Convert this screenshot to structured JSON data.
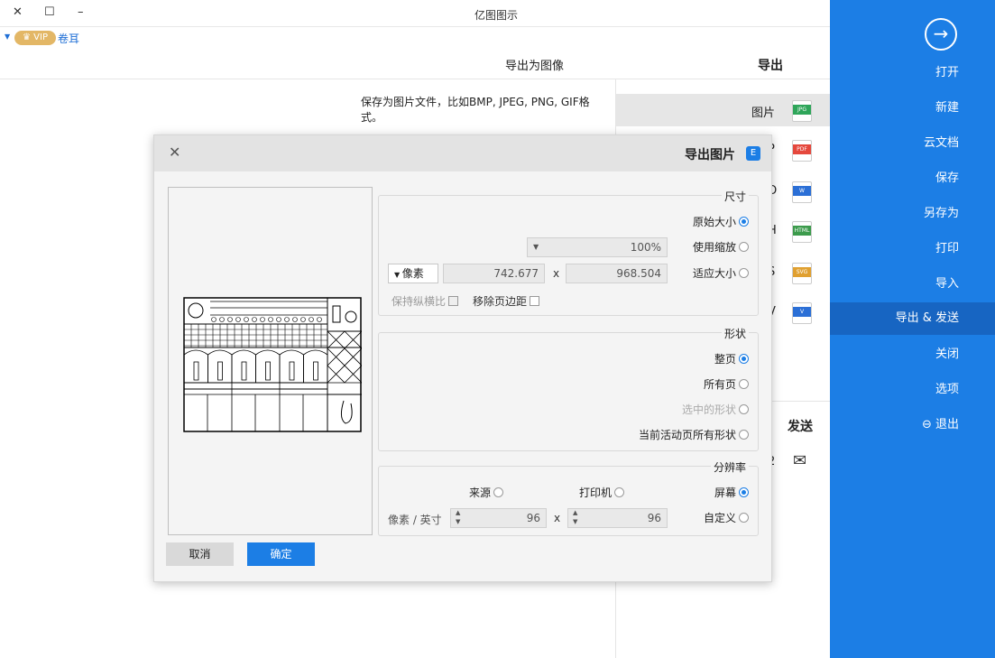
{
  "app": {
    "title": "亿图图示",
    "minimize": "–",
    "maximize": "☐",
    "close": "✕"
  },
  "user": {
    "name": "卷耳",
    "vip": "VIP"
  },
  "sidebar": {
    "items": [
      {
        "label": "打开"
      },
      {
        "label": "新建"
      },
      {
        "label": "云文档"
      },
      {
        "label": "保存"
      },
      {
        "label": "另存为"
      },
      {
        "label": "打印"
      },
      {
        "label": "导入"
      },
      {
        "label": "导出 & 发送"
      },
      {
        "label": "关闭"
      },
      {
        "label": "选项"
      },
      {
        "label": "退出"
      }
    ]
  },
  "export": {
    "title": "导出",
    "image_title": "导出为图像",
    "description": "保存为图片文件，比如BMP, JPEG, PNG, GIF格式。",
    "formats": [
      {
        "label": "图片",
        "tag": "JPG",
        "color": "#2fa65a"
      },
      {
        "label": "P",
        "tag": "PDF",
        "color": "#e5483d"
      },
      {
        "label": "O",
        "tag": "W",
        "color": "#2b6fd6"
      },
      {
        "label": "H",
        "tag": "HTML",
        "color": "#3c9b4c"
      },
      {
        "label": "S",
        "tag": "SVG",
        "color": "#e0a030"
      },
      {
        "label": "V",
        "tag": "V",
        "color": "#2b6fd6"
      }
    ],
    "send_title": "发送",
    "send_item": "2"
  },
  "dialog": {
    "title": "导出图片",
    "logo": "E",
    "close": "✕",
    "size": {
      "title": "尺寸",
      "original": "原始大小",
      "zoom": "使用缩放",
      "zoom_value": "100%",
      "fit": "适应大小",
      "width": "968.504",
      "height": "742.677",
      "unit": "像素",
      "remove_margin": "移除页边距",
      "keep_ratio": "保持纵横比"
    },
    "shape": {
      "title": "形状",
      "whole_page": "整页",
      "all_pages": "所有页",
      "selected": "选中的形状",
      "current_page_shapes": "当前活动页所有形状"
    },
    "resolution": {
      "title": "分辨率",
      "screen": "屏幕",
      "printer": "打印机",
      "source": "来源",
      "custom": "自定义",
      "x_value": "96",
      "y_value": "96",
      "unit": "像素 / 英寸"
    },
    "ok": "确定",
    "cancel": "取消"
  }
}
